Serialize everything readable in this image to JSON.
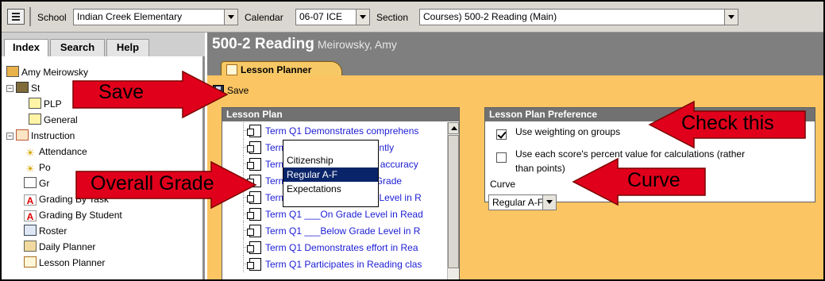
{
  "toolbar": {
    "school_label": "School",
    "school_value": "Indian Creek Elementary",
    "calendar_label": "Calendar",
    "calendar_value": "06-07 ICE",
    "section_label": "Section",
    "section_value": "Courses) 500-2 Reading (Main)"
  },
  "nav": {
    "tabs": [
      "Index",
      "Search",
      "Help"
    ],
    "tree": {
      "user": "Amy Meirowsky",
      "student_folder": "St",
      "plp": "PLP",
      "general": "General",
      "instruction": "Instruction",
      "attendance": "Attendance",
      "po": "Po",
      "gr": "Gr",
      "grading_by_task": "Grading By Task",
      "grading_by_student": "Grading By Student",
      "roster": "Roster",
      "daily_planner": "Daily Planner",
      "lesson_planner": "Lesson Planner"
    }
  },
  "header": {
    "title": "500-2 Reading",
    "teacher": "Meirowsky, Amy",
    "active_tab": "Lesson Planner"
  },
  "save_label": "Save",
  "lesson_plan": {
    "title": "Lesson Plan",
    "items": [
      "Term Q1 Demonstrates comprehens",
      "Term Q1 Reads independently",
      "Term Q1 Reads aloud with accuracy",
      "Term Q1 Overall Reading Grade",
      "Term Q1 ___Above Grade Level in R",
      "Term Q1 ___On Grade Level in Read",
      "Term Q1 ___Below Grade Level in R",
      "Term Q1 Demonstrates effort in Rea",
      "Term Q1 Participates in Reading clas"
    ]
  },
  "preference": {
    "title": "Lesson Plan Preference",
    "weighting_label": "Use weighting on groups",
    "weighting_checked": true,
    "percent_label_line1": "Use each score's percent value for calculations (rather",
    "percent_label_line2": "than points)",
    "percent_checked": false,
    "curve_label": "Curve",
    "curve_value": "Regular A-F",
    "curve_options": [
      "Citizenship",
      "Regular A-F",
      "Expectations"
    ],
    "curve_selected_index": 1
  },
  "callouts": {
    "save": "Save",
    "overall_grade": "Overall Grade",
    "check_this": "Check this",
    "curve": "Curve"
  },
  "colors": {
    "arrow_red": "#e0001b",
    "content_bg": "#fbc563",
    "panel_header": "#717171",
    "link_blue": "#1c1cd6",
    "selected_option": "#0a246a"
  }
}
